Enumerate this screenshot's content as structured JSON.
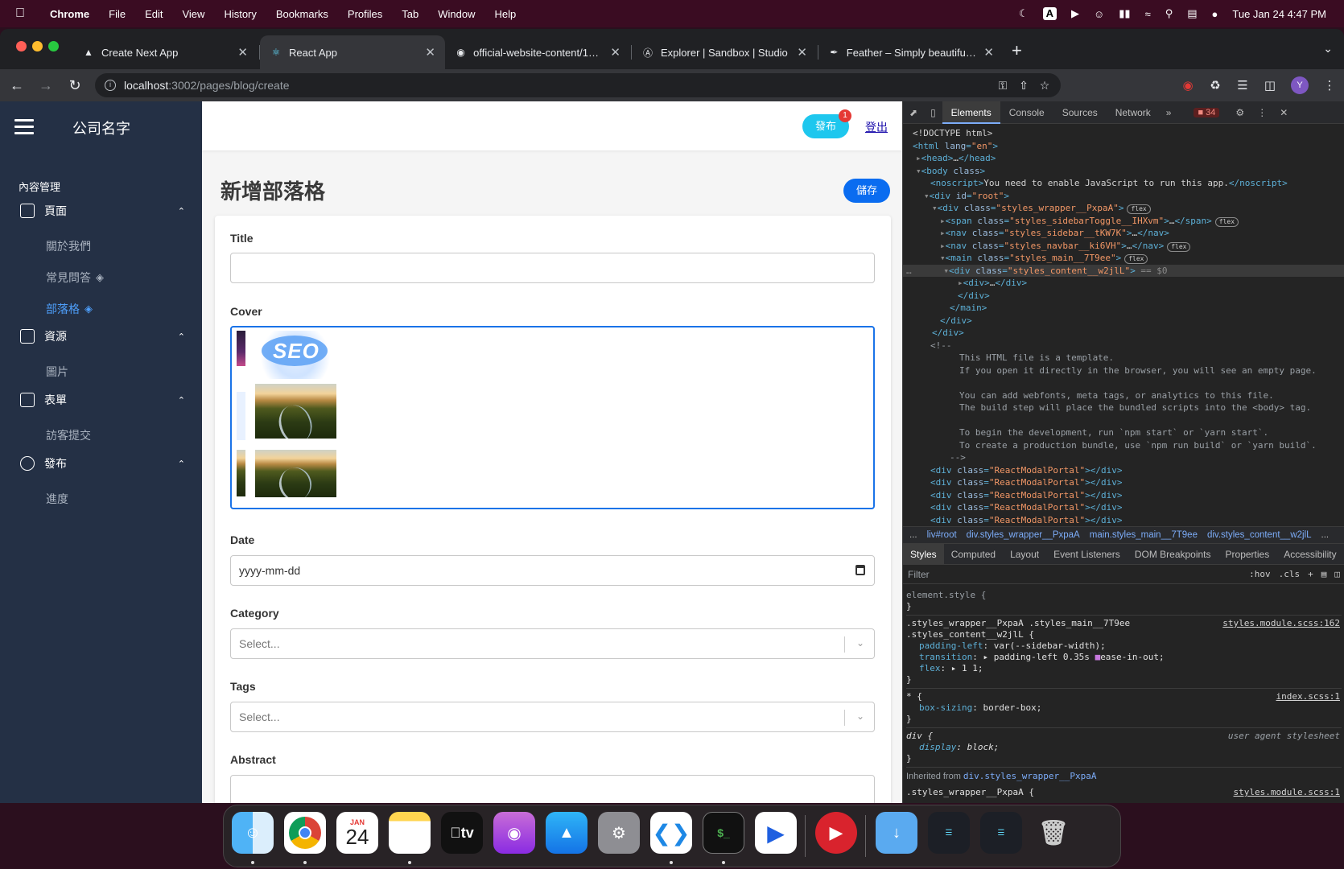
{
  "menubar": {
    "app_name": "Chrome",
    "menus": [
      "File",
      "Edit",
      "View",
      "History",
      "Bookmarks",
      "Profiles",
      "Tab",
      "Window",
      "Help"
    ],
    "input_source": "A",
    "datetime": "Tue Jan 24  4:47 PM"
  },
  "tabs": [
    {
      "title": "Create Next App"
    },
    {
      "title": "React App"
    },
    {
      "title": "official-website-content/16745"
    },
    {
      "title": "Explorer | Sandbox | Studio"
    },
    {
      "title": "Feather – Simply beautiful ope"
    }
  ],
  "omnibox": {
    "host": "localhost",
    "path": ":3002/pages/blog/create"
  },
  "profile_initial": "Y",
  "sidebar": {
    "company": "公司名字",
    "section": "內容管理",
    "groups": [
      {
        "label": "頁面",
        "items": [
          {
            "label": "關於我們"
          },
          {
            "label": "常見問答"
          },
          {
            "label": "部落格"
          }
        ]
      },
      {
        "label": "資源",
        "items": [
          {
            "label": "圖片"
          }
        ]
      },
      {
        "label": "表單",
        "items": [
          {
            "label": "訪客提交"
          }
        ]
      },
      {
        "label": "發布",
        "items": [
          {
            "label": "進度"
          }
        ]
      }
    ]
  },
  "navbar": {
    "publish_label": "發布",
    "publish_badge": "1",
    "logout_label": "登出"
  },
  "page": {
    "title": "新增部落格",
    "save_label": "儲存",
    "fields": {
      "title_label": "Title",
      "cover_label": "Cover",
      "date_label": "Date",
      "date_value": "yyyy-mm-dd",
      "category_label": "Category",
      "category_placeholder": "Select...",
      "tags_label": "Tags",
      "tags_placeholder": "Select...",
      "abstract_label": "Abstract"
    },
    "cover_text": "SEO"
  },
  "devtools": {
    "tabs": [
      "Elements",
      "Console",
      "Sources",
      "Network"
    ],
    "error_count": "34",
    "crumbs": [
      "...",
      "liv#root",
      "div.styles_wrapper__PxpaA",
      "main.styles_main__7T9ee",
      "div.styles_content__w2jlL",
      "..."
    ],
    "subtabs": [
      "Styles",
      "Computed",
      "Layout",
      "Event Listeners",
      "DOM Breakpoints",
      "Properties",
      "Accessibility"
    ],
    "filter_placeholder": "Filter",
    "filter_tools": [
      ":hov",
      ".cls",
      "+"
    ],
    "inherited_prefix": "Inherited from ",
    "inherited_from": "div.styles_wrapper__PxpaA",
    "flex_badge": "flex"
  },
  "dock": {
    "calendar_month": "JAN",
    "calendar_day": "24",
    "tv_label": "tv"
  }
}
